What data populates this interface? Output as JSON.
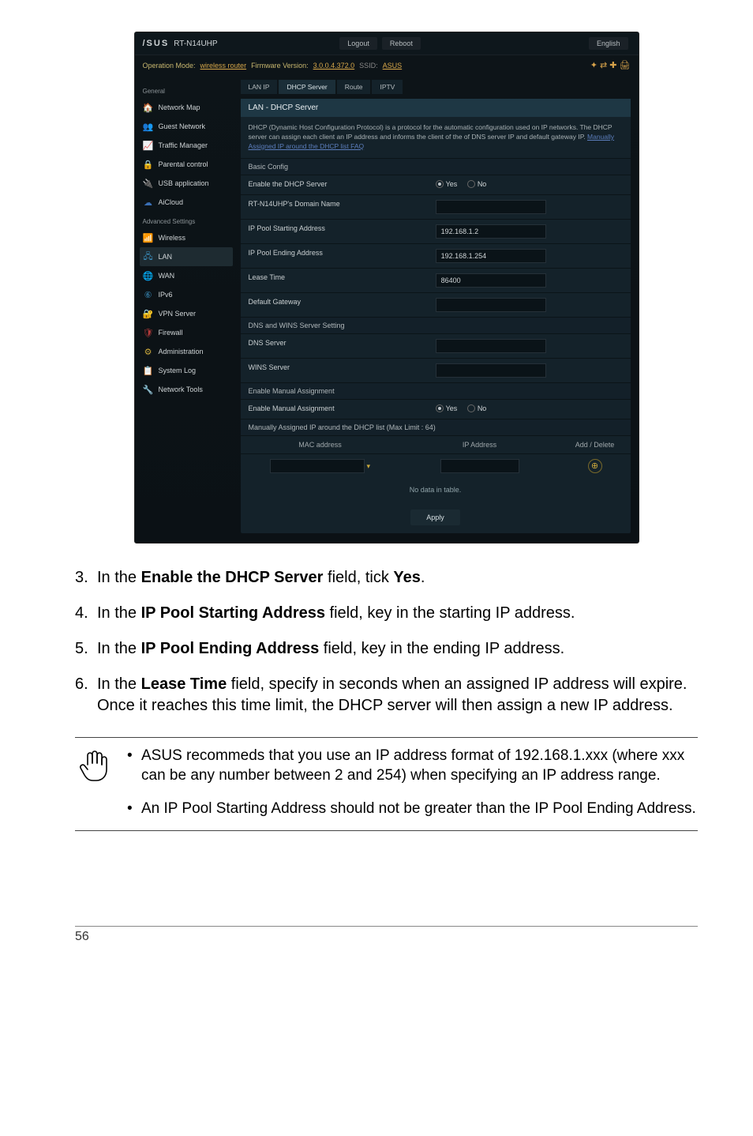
{
  "screenshot": {
    "logo": "/SUS",
    "model": "RT-N14UHP",
    "top_buttons": {
      "logout": "Logout",
      "reboot": "Reboot"
    },
    "lang": "English",
    "opmode_label": "Operation Mode:",
    "opmode_value": "wireless router",
    "fw_label": "Firmware Version:",
    "fw_value": "3.0.0.4.372.0",
    "ssid_label": "SSID:",
    "ssid_value": "ASUS",
    "sidebar": {
      "cat1": "General",
      "items1": [
        "Network Map",
        "Guest Network",
        "Traffic Manager",
        "Parental control",
        "USB application",
        "AiCloud"
      ],
      "cat2": "Advanced Settings",
      "items2": [
        "Wireless",
        "LAN",
        "WAN",
        "IPv6",
        "VPN Server",
        "Firewall",
        "Administration",
        "System Log",
        "Network Tools"
      ]
    },
    "tabs": [
      "LAN IP",
      "DHCP Server",
      "Route",
      "IPTV"
    ],
    "panel_title": "LAN - DHCP Server",
    "panel_desc_1": "DHCP (Dynamic Host Configuration Protocol) is a protocol for the automatic configuration used on IP networks. The DHCP server can assign each client an IP address and informs the client of the of DNS server IP and default gateway IP.",
    "panel_desc_link": "Manually Assigned IP around the DHCP list FAQ",
    "sect1": "Basic Config",
    "rows": {
      "enable": "Enable the DHCP Server",
      "yes": "Yes",
      "no": "No",
      "domain": "RT-N14UHP's Domain Name",
      "start": "IP Pool Starting Address",
      "start_v": "192.168.1.2",
      "end": "IP Pool Ending Address",
      "end_v": "192.168.1.254",
      "lease": "Lease Time",
      "lease_v": "86400",
      "gateway": "Default Gateway"
    },
    "sect2": "DNS and WINS Server Setting",
    "dns": "DNS Server",
    "wins": "WINS Server",
    "sect3": "Enable Manual Assignment",
    "manual": "Enable Manual Assignment",
    "sect4": "Manually Assigned IP around the DHCP list (Max Limit : 64)",
    "man_cols": {
      "mac": "MAC address",
      "ip": "IP Address",
      "add": "Add / Delete"
    },
    "nodata": "No data in table.",
    "apply": "Apply"
  },
  "steps": {
    "s3n": "3.",
    "s3a": "In the ",
    "s3b": "Enable the DHCP Server",
    "s3c": " field, tick ",
    "s3d": "Yes",
    "s3e": ".",
    "s4n": "4.",
    "s4a": "In the ",
    "s4b": "IP Pool Starting Address",
    "s4c": " field, key in the starting IP address.",
    "s5n": "5.",
    "s5a": "In the ",
    "s5b": "IP Pool Ending Address",
    "s5c": " field, key in the ending IP address.",
    "s6n": "6.",
    "s6a": "In the ",
    "s6b": "Lease Time",
    "s6c": " field, specify in seconds when an assigned IP address will expire. Once it reaches this time limit, the DHCP server will then assign a new IP address."
  },
  "notes": {
    "n1": "ASUS recommeds that you use an IP address format of 192.168.1.xxx (where xxx can be any number between 2 and 254) when specifying an IP address range.",
    "n2": "An IP Pool Starting Address should not be greater than the IP Pool Ending Address."
  },
  "bullet": "•",
  "pagenum": "56"
}
